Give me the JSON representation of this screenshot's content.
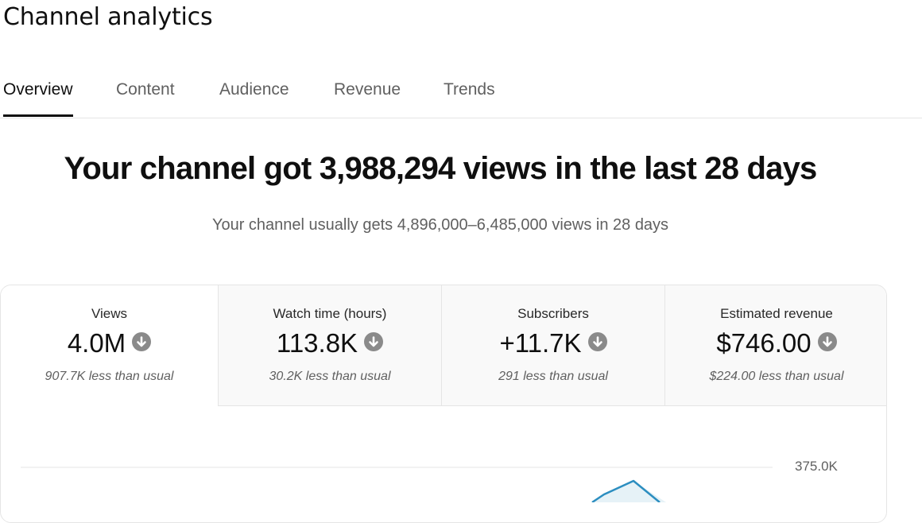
{
  "header": {
    "title": "Channel analytics"
  },
  "tabs": [
    {
      "label": "Overview",
      "active": true
    },
    {
      "label": "Content"
    },
    {
      "label": "Audience"
    },
    {
      "label": "Revenue"
    },
    {
      "label": "Trends"
    }
  ],
  "summary": {
    "headline": "Your channel got 3,988,294 views in the last 28 days",
    "subline": "Your channel usually gets 4,896,000–6,485,000 views in 28 days"
  },
  "cards": [
    {
      "label": "Views",
      "value": "4.0M",
      "delta": "907.7K less than usual",
      "trend_icon": "arrow-down-circle-icon",
      "selected": true
    },
    {
      "label": "Watch time (hours)",
      "value": "113.8K",
      "delta": "30.2K less than usual",
      "trend_icon": "arrow-down-circle-icon"
    },
    {
      "label": "Subscribers",
      "value": "+11.7K",
      "delta": "291 less than usual",
      "trend_icon": "arrow-down-circle-icon"
    },
    {
      "label": "Estimated revenue",
      "value": "$746.00",
      "delta": "$224.00 less than usual",
      "trend_icon": "arrow-down-circle-icon"
    }
  ],
  "chart": {
    "y_tick_label": "375.0K",
    "line_color": "#2c8ec0",
    "area_color": "#e6f2f7",
    "grid_color": "#e5e5e5"
  }
}
